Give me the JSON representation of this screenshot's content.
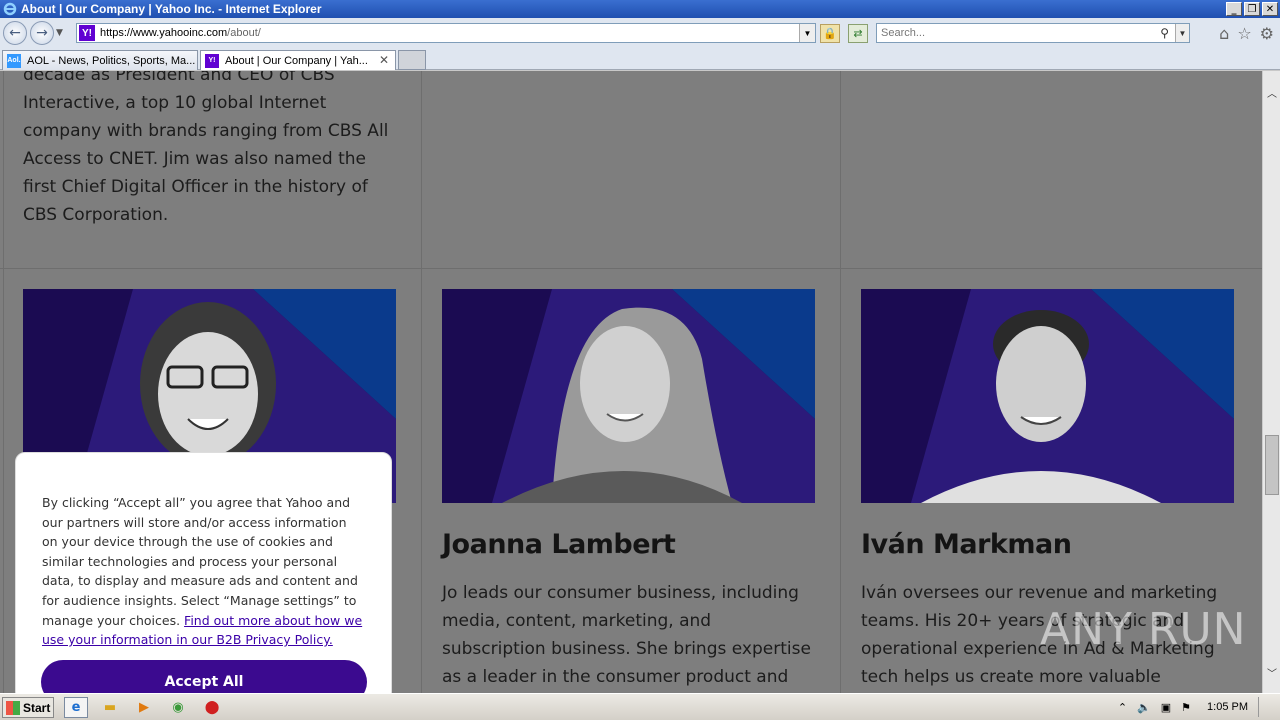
{
  "window": {
    "title": "About | Our Company | Yahoo Inc. - Internet Explorer",
    "buttons": [
      "_",
      "❐",
      "X"
    ]
  },
  "address_bar": {
    "url_host": "https://www.yahooinc.com",
    "url_path": "/about/",
    "favicon": "Y!"
  },
  "search": {
    "placeholder": "Search..."
  },
  "tabs": [
    {
      "label": "AOL - News, Politics, Sports, Ma...",
      "favicon": "Aol.",
      "active": false
    },
    {
      "label": "About | Our Company | Yah...",
      "favicon": "Y!",
      "active": true
    }
  ],
  "page": {
    "top_bio": "decade as President and CEO of CBS Interactive, a top 10 global Internet company with brands ranging from CBS All Access to CNET. Jim was also named the first Chief Digital Officer in the history of CBS Corporation.",
    "people": [
      {
        "name": "",
        "bio": ""
      },
      {
        "name": "Joanna Lambert",
        "bio": "Jo leads our consumer business, including media, content, marketing, and subscription business. She brings expertise as a leader in the consumer product and financial services"
      },
      {
        "name": "Iván Markman",
        "bio": "Iván oversees our revenue and marketing teams. His 20+ years of strategic and operational experience in Ad & Marketing tech helps us create more valuable"
      }
    ]
  },
  "cookie_dialog": {
    "text": "By clicking “Accept all” you agree that Yahoo and our partners will store and/or access information on your device through the use of cookies and similar technologies and process your personal data, to display and measure ads and content and for audience insights. Select “Manage settings” to manage your choices. ",
    "link": "Find out more about how we use your information in our B2B Privacy Policy.",
    "accept_label": "Accept All"
  },
  "watermark": "ANY RUN",
  "taskbar": {
    "start_label": "Start",
    "clock": "1:05 PM"
  },
  "colors": {
    "accent_purple": "#3b0a8f",
    "yahoo_purple": "#6001d2",
    "card_bg": "#24135f"
  }
}
